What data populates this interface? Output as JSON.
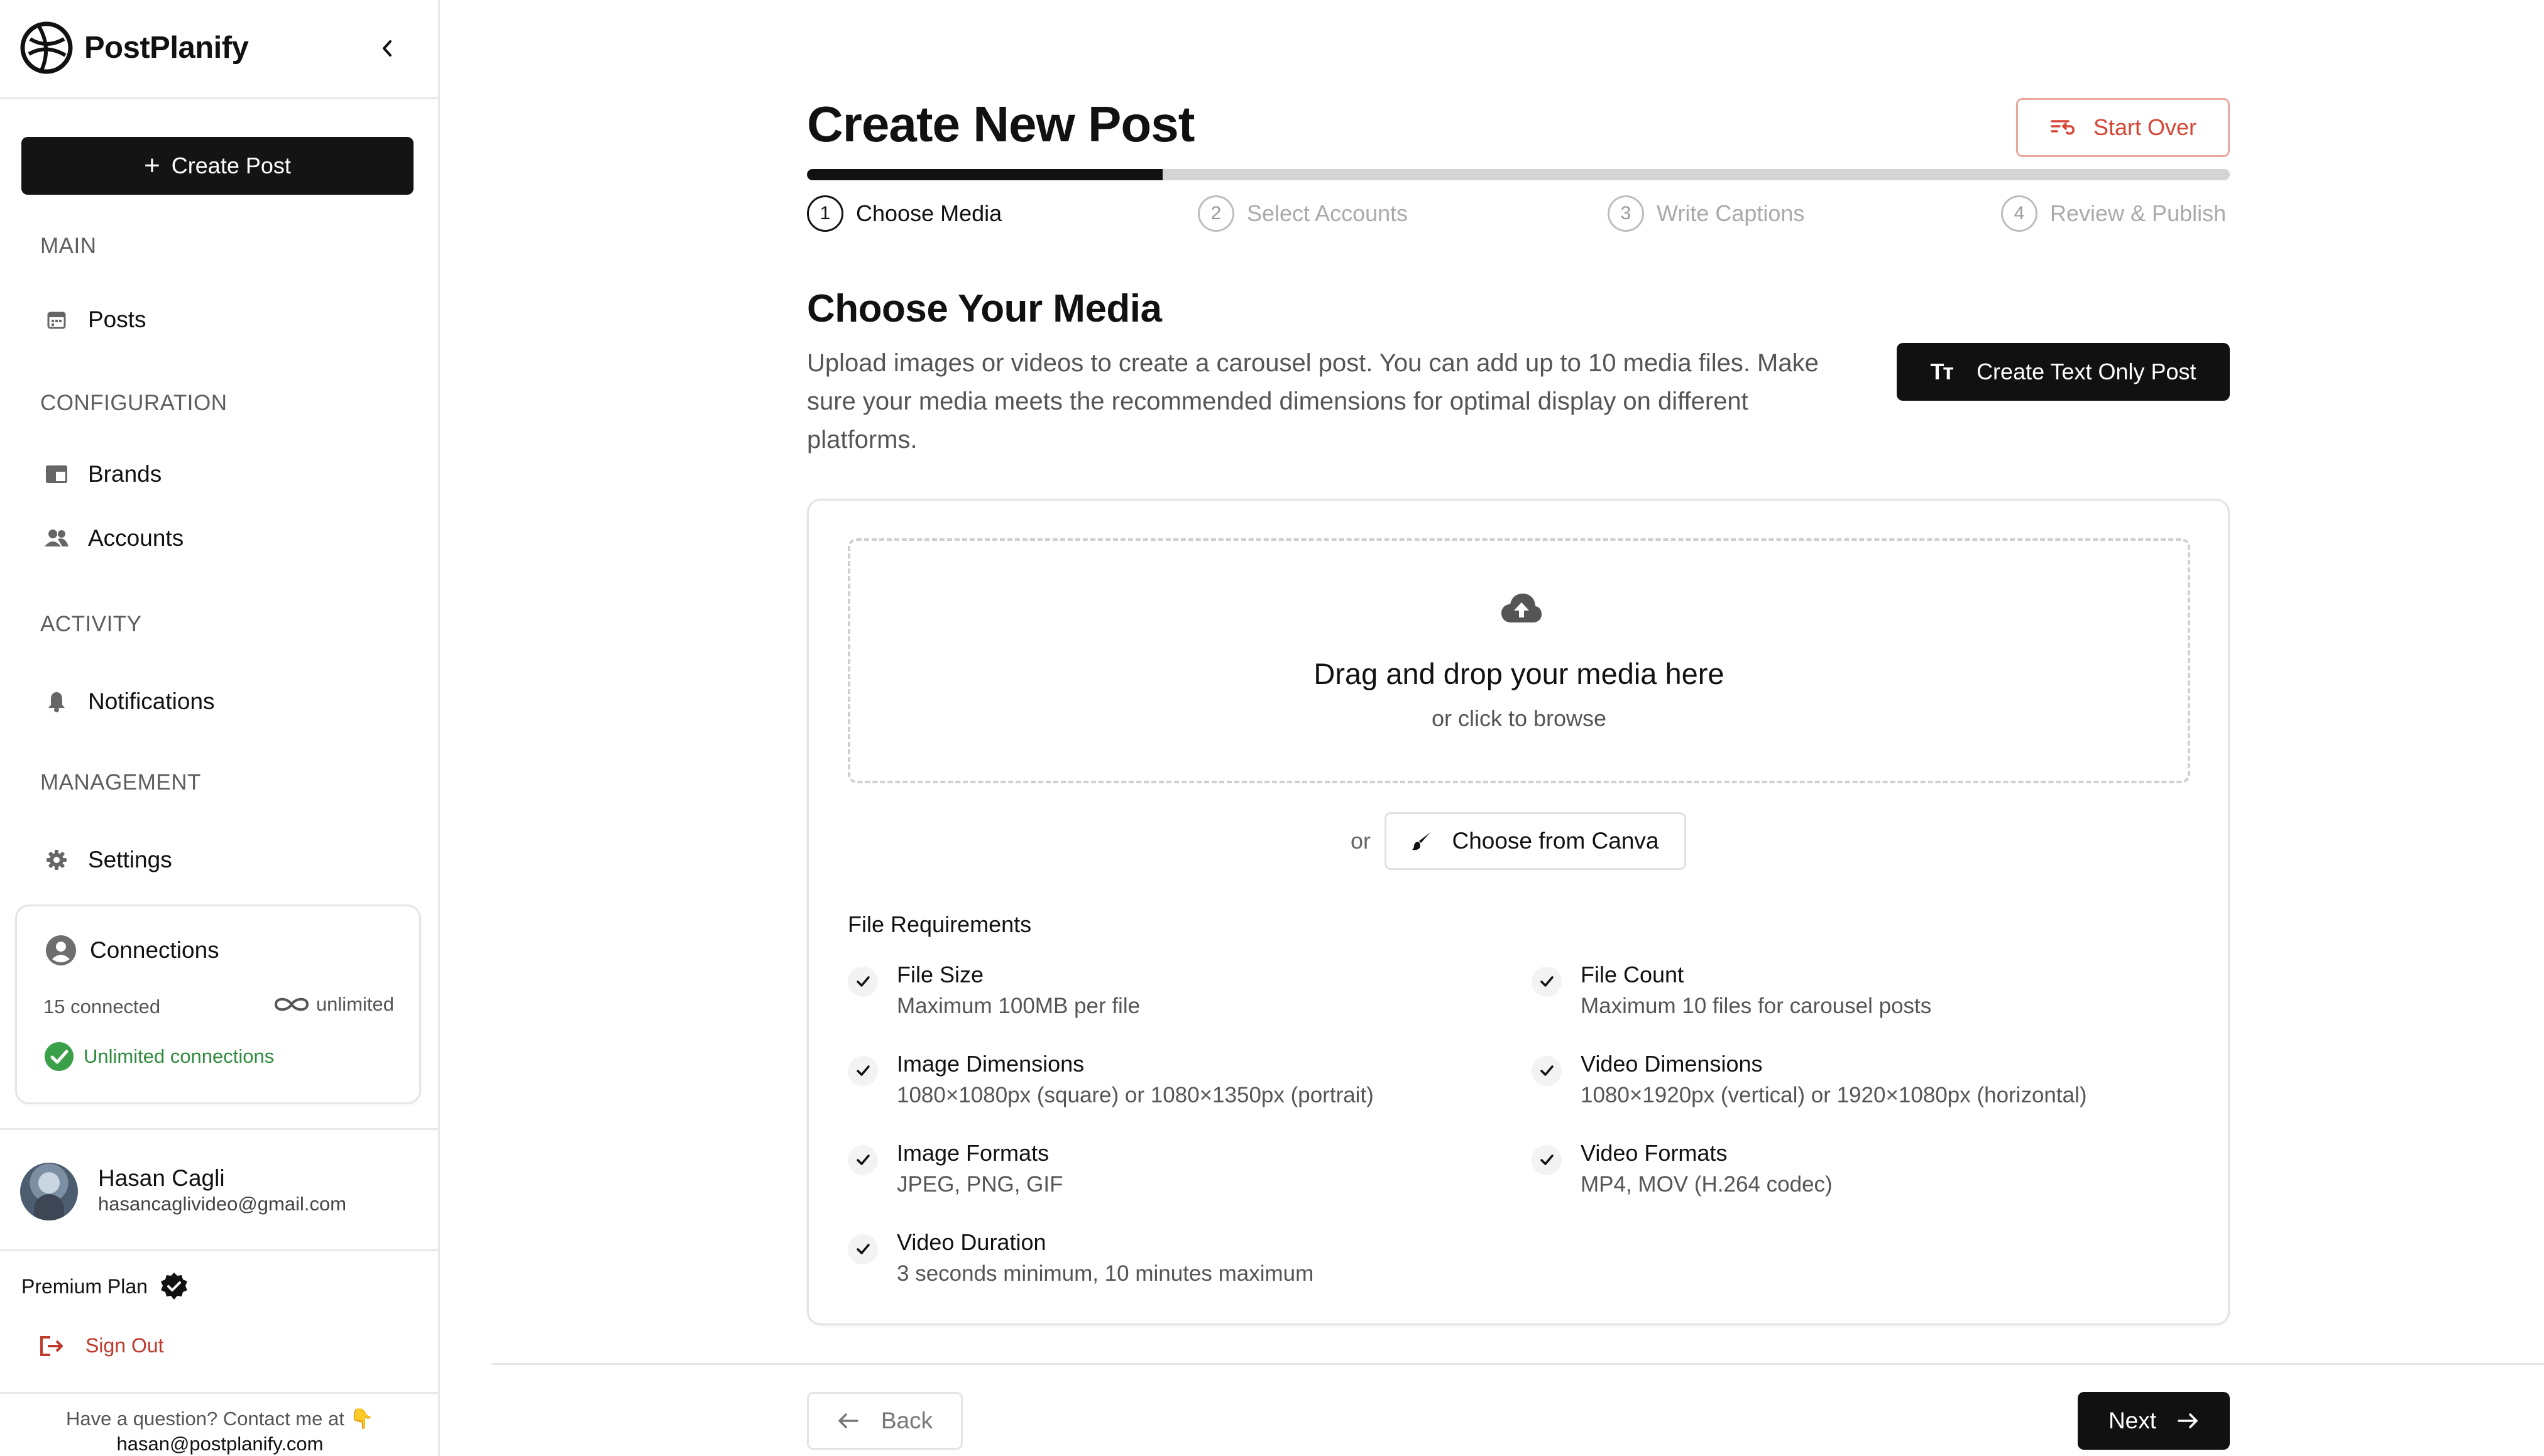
{
  "app": {
    "name": "PostPlanify"
  },
  "sidebar": {
    "create_post_label": "Create Post",
    "sections": [
      {
        "label": "MAIN",
        "items": [
          {
            "label": "Posts",
            "icon": "calendar-icon"
          }
        ]
      },
      {
        "label": "CONFIGURATION",
        "items": [
          {
            "label": "Brands",
            "icon": "brand-card-icon"
          },
          {
            "label": "Accounts",
            "icon": "users-icon"
          }
        ]
      },
      {
        "label": "ACTIVITY",
        "items": [
          {
            "label": "Notifications",
            "icon": "bell-icon"
          }
        ]
      },
      {
        "label": "MANAGEMENT",
        "items": [
          {
            "label": "Settings",
            "icon": "gear-icon"
          }
        ]
      }
    ],
    "connections": {
      "title": "Connections",
      "count": "15 connected",
      "limit": "unlimited",
      "status": "Unlimited connections"
    },
    "user": {
      "name": "Hasan Cagli",
      "email": "hasancaglivideo@gmail.com"
    },
    "plan": "Premium Plan",
    "sign_out": "Sign Out",
    "contact": {
      "text": "Have a question? Contact me at 👇",
      "email": "hasan@postplanify.com"
    }
  },
  "main": {
    "title": "Create New Post",
    "start_over": "Start Over",
    "progress": 0.25,
    "steps": [
      {
        "num": "1",
        "label": "Choose Media",
        "active": true
      },
      {
        "num": "2",
        "label": "Select Accounts",
        "active": false
      },
      {
        "num": "3",
        "label": "Write Captions",
        "active": false
      },
      {
        "num": "4",
        "label": "Review & Publish",
        "active": false
      }
    ],
    "section_title": "Choose Your Media",
    "section_desc": "Upload images or videos to create a carousel post. You can add up to 10 media files. Make sure your media meets the recommended dimensions for optimal display on different platforms.",
    "text_only_label": "Create Text Only Post",
    "text_only_icon_text": "Tт",
    "dropzone": {
      "title": "Drag and drop your media here",
      "subtitle": "or click to browse"
    },
    "or_text": "or",
    "canva_label": "Choose from Canva",
    "requirements_title": "File Requirements",
    "requirements": [
      {
        "title": "File Size",
        "desc": "Maximum 100MB per file"
      },
      {
        "title": "File Count",
        "desc": "Maximum 10 files for carousel posts"
      },
      {
        "title": "Image Dimensions",
        "desc": "1080×1080px (square) or 1080×1350px (portrait)"
      },
      {
        "title": "Video Dimensions",
        "desc": "1080×1920px (vertical) or 1920×1080px (horizontal)"
      },
      {
        "title": "Image Formats",
        "desc": "JPEG, PNG, GIF"
      },
      {
        "title": "Video Formats",
        "desc": "MP4, MOV (H.264 codec)"
      },
      {
        "title": "Video Duration",
        "desc": "3 seconds minimum, 10 minutes maximum"
      }
    ],
    "back_label": "Back",
    "next_label": "Next"
  },
  "colors": {
    "primary": "#111111",
    "danger": "#d64535",
    "success": "#2e8b3d",
    "muted": "#aaaaaa"
  }
}
